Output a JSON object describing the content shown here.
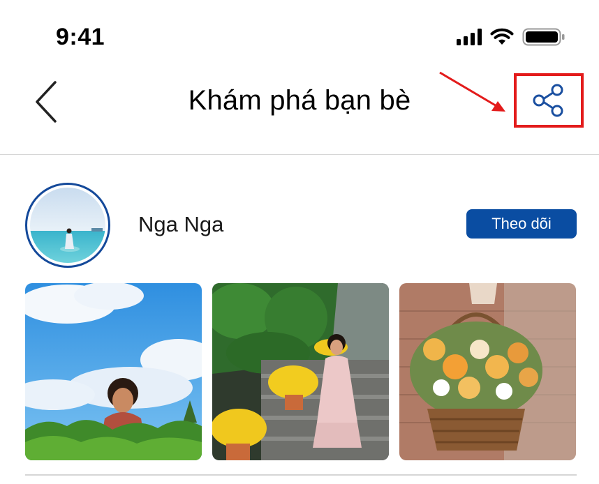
{
  "status_bar": {
    "time": "9:41",
    "icons": [
      "signal-icon",
      "wifi-icon",
      "battery-icon"
    ]
  },
  "header": {
    "title": "Khám phá bạn bè",
    "back_icon": "chevron-left-icon",
    "share_icon": "share-icon",
    "highlight_color": "#e31b1b"
  },
  "profile": {
    "name": "Nga Nga",
    "follow_label": "Theo dõi",
    "accent_color": "#0a4da2"
  },
  "photos": [
    {
      "name": "photo-girl-tea-field"
    },
    {
      "name": "photo-woman-steps-flowers"
    },
    {
      "name": "photo-flower-basket"
    }
  ]
}
